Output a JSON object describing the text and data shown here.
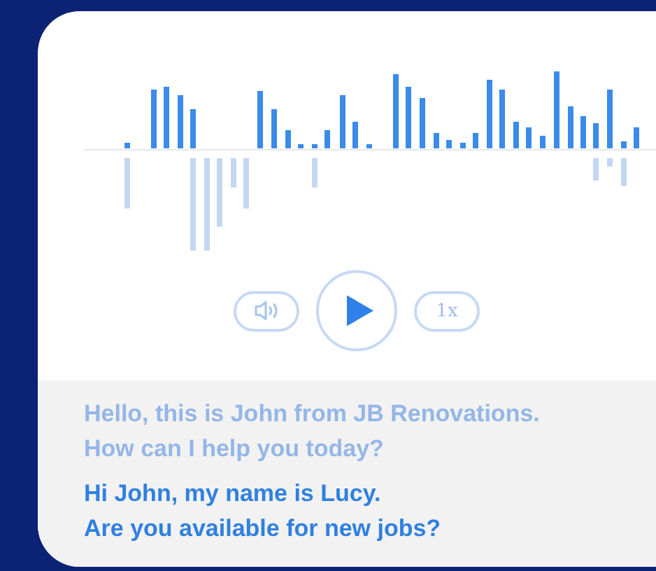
{
  "player": {
    "speed": "1x"
  },
  "messages": [
    {
      "lines": [
        "Hello, this is John from JB Renovations.",
        "How can I help you today?"
      ],
      "active": false
    },
    {
      "lines": [
        "Hi John, my name is Lucy.",
        "Are you available for new jobs?"
      ],
      "active": true
    }
  ]
}
